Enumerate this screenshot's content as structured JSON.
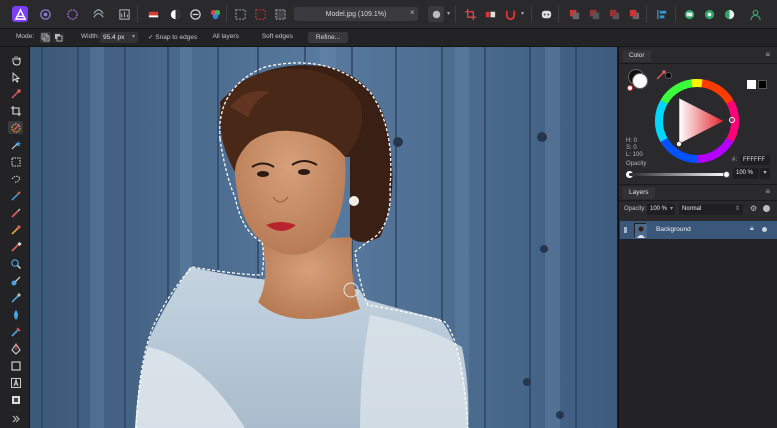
{
  "document": {
    "title": "Model.jpg (109.1%)"
  },
  "context_toolbar": {
    "mode_label": "Mode:",
    "width_label": "Width:",
    "width_value": "95.4 px",
    "snap_label": "Snap to edges",
    "all_layers_label": "All layers",
    "soft_edges_label": "Soft edges",
    "refine_label": "Refine..."
  },
  "color_panel": {
    "tab": "Color",
    "h": "H: 0",
    "s": "S: 0",
    "l": "L: 100",
    "hex_label": "#:",
    "hex_value": "FFFFFF",
    "opacity_label": "Opacity",
    "opacity_value": "100 %"
  },
  "layers_panel": {
    "tab": "Layers",
    "opacity_label": "Opacity:",
    "opacity_value": "100 %",
    "blend_mode": "Normal",
    "layers": [
      {
        "name": "Background"
      }
    ]
  },
  "icons": {
    "app": "affinity-photo-logo-icon",
    "panel_menu": "hamburger-menu-icon",
    "expand_tools": "double-chevron-right-icon"
  },
  "colors": {
    "accent": "#3a5678",
    "app_logo": "#7a3ff2",
    "wheel_triangle": "#e0232a"
  }
}
